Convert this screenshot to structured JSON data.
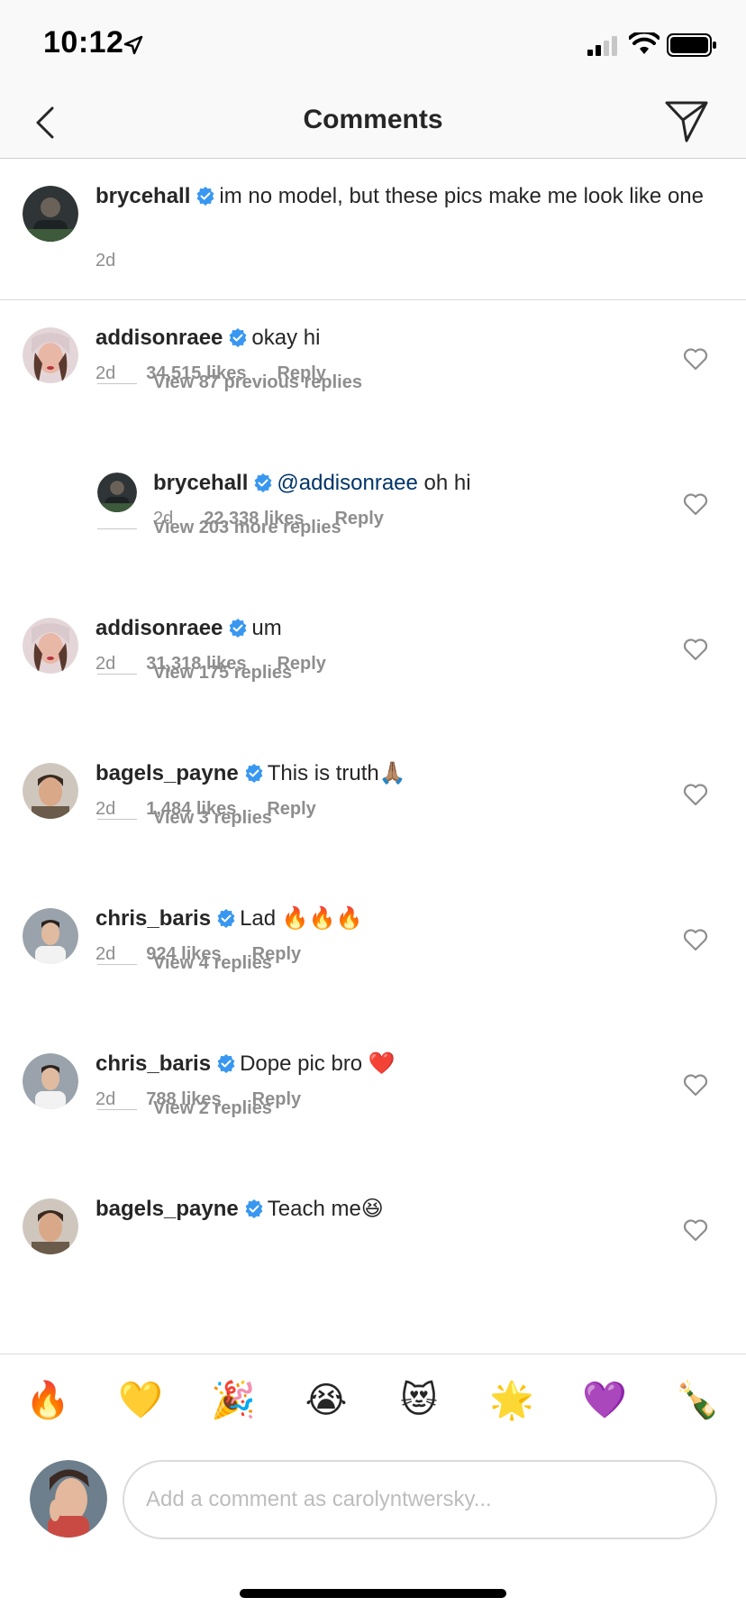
{
  "status_bar": {
    "time": "10:12"
  },
  "nav": {
    "title": "Comments"
  },
  "caption": {
    "username": "brycehall",
    "text": "im no model, but these pics make me look like one",
    "time": "2d"
  },
  "comments": [
    {
      "username": "addisonraee",
      "text": "okay hi",
      "time": "2d",
      "likes": "34,515 likes",
      "reply_label": "Reply",
      "view_replies": "View 87 previous replies"
    },
    {
      "username": "brycehall",
      "mention": "@addisonraee",
      "text": "oh hi",
      "time": "2d",
      "likes": "22,338 likes",
      "reply_label": "Reply",
      "view_replies": "View 203 more replies"
    },
    {
      "username": "addisonraee",
      "text": "um",
      "time": "2d",
      "likes": "31,318 likes",
      "reply_label": "Reply",
      "view_replies": "View 175 replies"
    },
    {
      "username": "bagels_payne",
      "text": "This is truth🙏🏽",
      "time": "2d",
      "likes": "1,484 likes",
      "reply_label": "Reply",
      "view_replies": "View 3 replies"
    },
    {
      "username": "chris_baris",
      "text": "Lad 🔥🔥🔥",
      "time": "2d",
      "likes": "924 likes",
      "reply_label": "Reply",
      "view_replies": "View 4 replies"
    },
    {
      "username": "chris_baris",
      "text": "Dope pic bro ❤️",
      "time": "2d",
      "likes": "788 likes",
      "reply_label": "Reply",
      "view_replies": "View 2 replies"
    },
    {
      "username": "bagels_payne",
      "text": "Teach me😆"
    }
  ],
  "emoji_bar": [
    "🔥",
    "💛",
    "🎉",
    "😭",
    "😻",
    "🌟",
    "💜",
    "🍾"
  ],
  "input": {
    "placeholder": "Add a comment as carolyntwersky..."
  },
  "colors": {
    "verified": "#3897f0",
    "mention": "#003569",
    "secondary": "#8e8e8e"
  }
}
